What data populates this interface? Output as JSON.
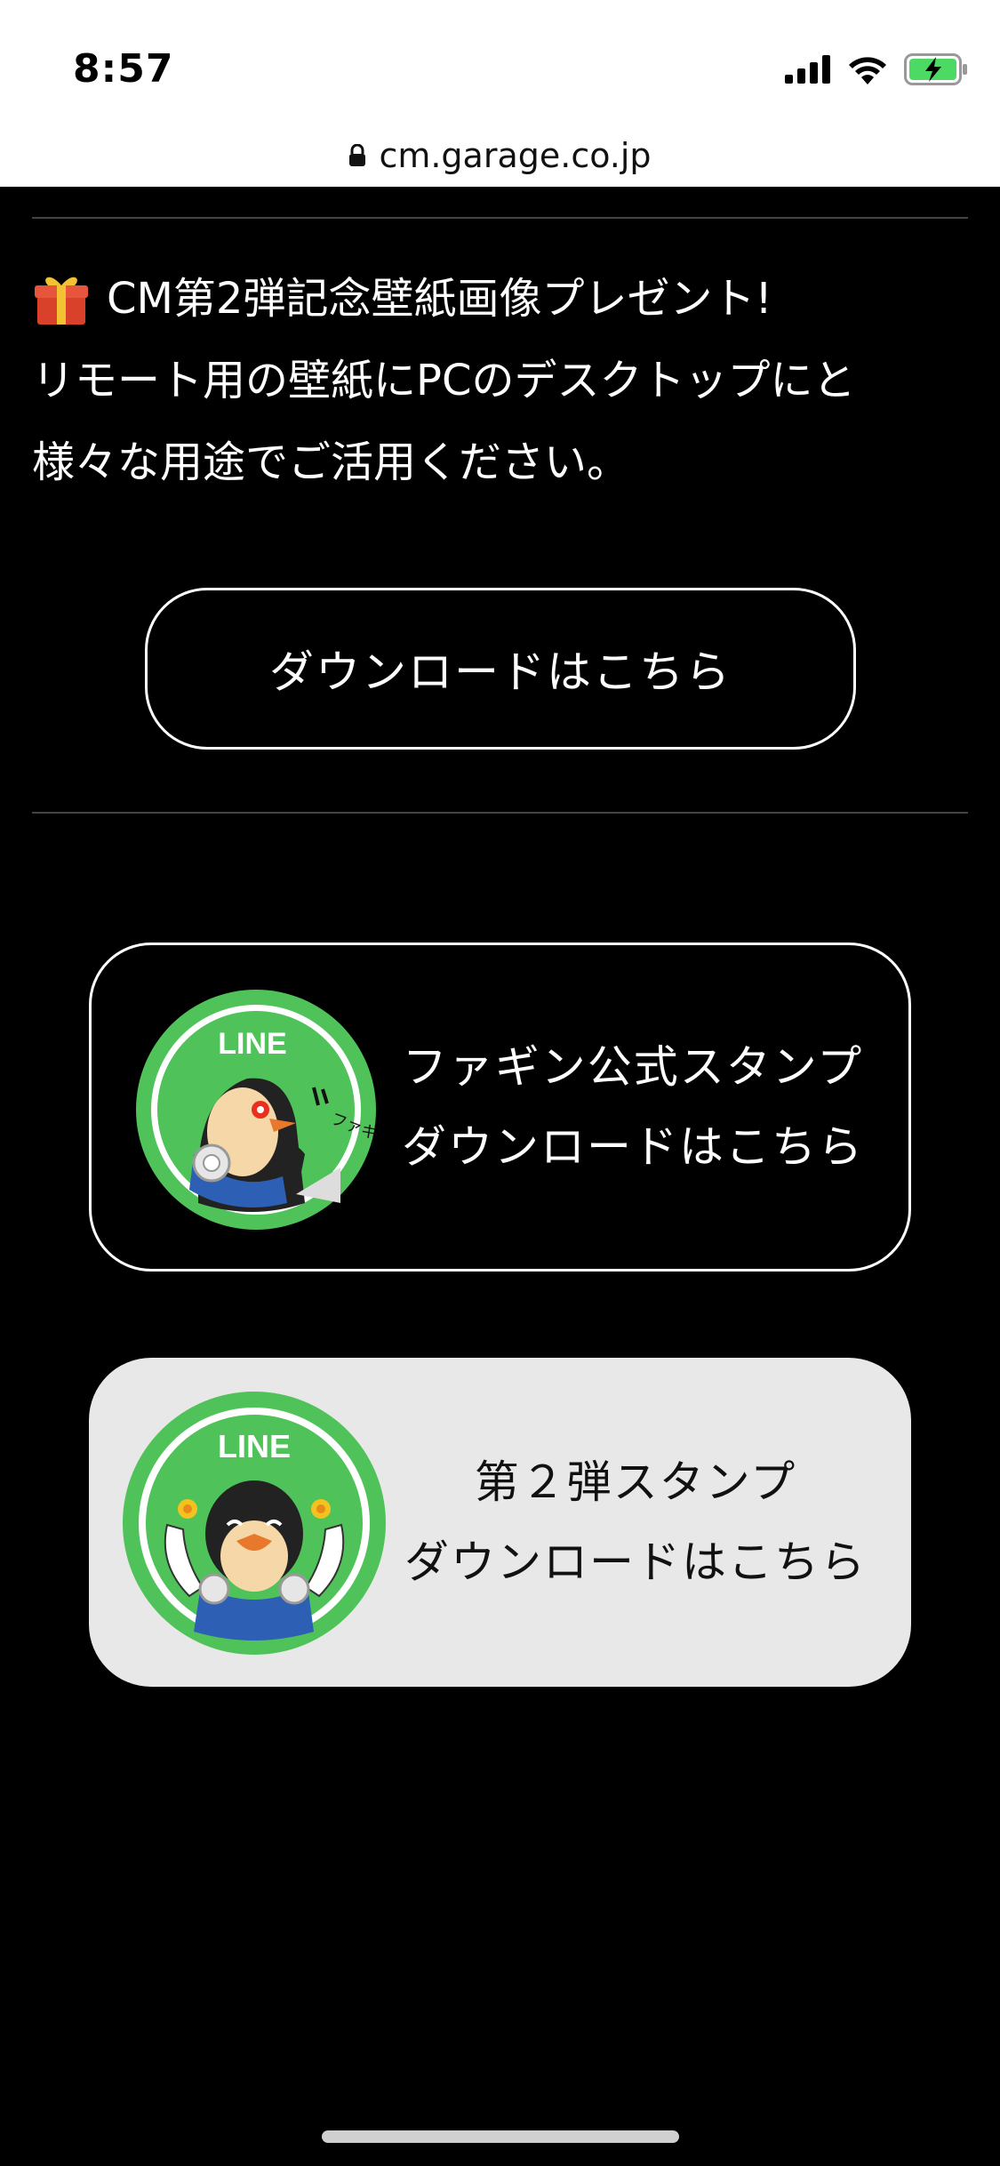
{
  "status": {
    "time": "8:57"
  },
  "browser": {
    "url": "cm.garage.co.jp"
  },
  "promo": {
    "line1": "CM第2弾記念壁紙画像プレゼント!",
    "line2": "リモート用の壁紙にPCのデスクトップにと",
    "line3": "様々な用途でご活用ください。"
  },
  "download_button": {
    "label": "ダウンロードはこちら"
  },
  "stamps": [
    {
      "badge": "LINE",
      "line1": "ファギン公式スタンプ",
      "line2": "ダウンロードはこちら"
    },
    {
      "badge": "LINE",
      "line1": "第２弾スタンプ",
      "line2": "ダウンロードはこちら"
    }
  ],
  "colors": {
    "background": "#000000",
    "line_green": "#4fc35a",
    "card_light": "#e8e8e8",
    "battery_green": "#4cd964"
  }
}
